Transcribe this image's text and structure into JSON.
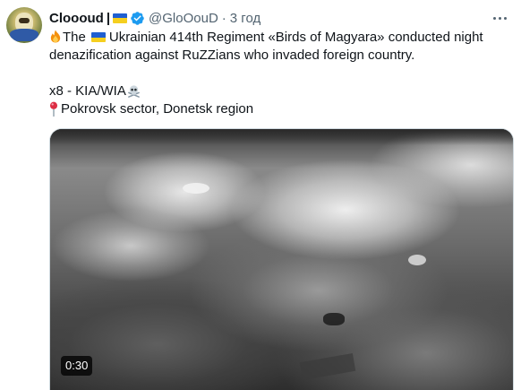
{
  "post": {
    "author": {
      "display_name": "Clooоud",
      "name_suffix": "|",
      "handle": "@GloOouD",
      "verified": true,
      "avatar_icon": "avatar-image"
    },
    "timestamp": "3 год",
    "timestamp_separator": "·",
    "more_icon": "more-horizontal-icon",
    "lines": {
      "l1_start": "The",
      "l1_rest": "Ukrainian 414th Regiment «Birds of Magyara» conducted night",
      "l2": "denazification against RuZZians who invaded foreign country.",
      "l3": "x8 - KIA/WIA",
      "l4": "Pokrovsk sector, Donetsk region"
    },
    "emoji": {
      "fire": "fire-icon",
      "flag": "ukraine-flag-icon",
      "skull": "skull-and-crossbones-icon",
      "pin": "round-pushpin-icon"
    },
    "media": {
      "type": "video",
      "duration": "0:30"
    }
  },
  "colors": {
    "text_primary": "#0f1419",
    "text_secondary": "#536471",
    "verified_blue": "#1d9bf0",
    "flag_blue": "#1f5fd1",
    "flag_yellow": "#f5cf1f"
  }
}
